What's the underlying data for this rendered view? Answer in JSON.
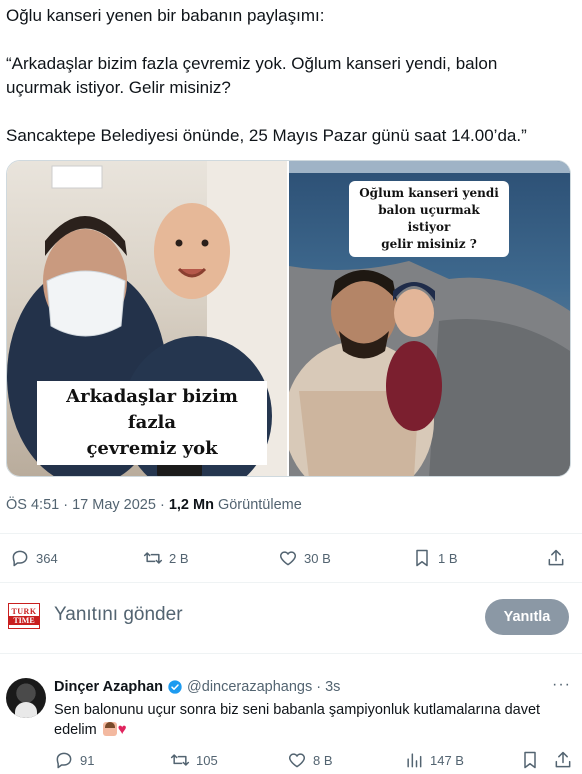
{
  "tweet": {
    "line1": "Oğlu kanseri yenen bir babanın paylaşımı:",
    "line2": "“Arkadaşlar bizim fazla çevremiz yok. Oğlum kanseri yendi, balon",
    "line3": "uçurmak istiyor. Gelir misiniz?",
    "line4": "Sancaktepe Belediyesi önünde, 25 Mayıs Pazar günü saat 14.00’da.”"
  },
  "media": {
    "left_caption_line1": "Arkadaşlar bizim fazla",
    "left_caption_line2": "çevremiz yok",
    "right_caption_line1": "Oğlum kanseri yendi",
    "right_caption_line2": "balon uçurmak istiyor",
    "right_caption_line3": "gelir misiniz ?"
  },
  "meta": {
    "time": "ÖS 4:51 · 17 May 2025 · ",
    "views_count": "1,2 Mn",
    "views_label": " Görüntüleme"
  },
  "actions": {
    "replies": "364",
    "retweets": "2 B",
    "likes": "30 B",
    "bookmarks": "1 B"
  },
  "compose": {
    "logo_top": "TURK",
    "logo_bottom": "TIME",
    "placeholder": "Yanıtını gönder",
    "reply_button": "Yanıtla"
  },
  "reply": {
    "name": "Dinçer Azaphan",
    "handle": "@dincerazaphangs",
    "time": "· 3s",
    "text": "Sen balonunu uçur sonra biz seni babanla şampiyonluk kutlamalarına davet",
    "text_line2": "edelim",
    "replies": "91",
    "retweets": "105",
    "likes": "8 B",
    "views": "147 B"
  },
  "colors": {
    "accent": "#1d9bf0",
    "muted": "#536471",
    "reply_button_bg": "#8b98a5",
    "heart": "#e0245e"
  },
  "icons": [
    "reply-icon",
    "retweet-icon",
    "like-icon",
    "bookmark-icon",
    "share-icon",
    "more-icon",
    "verified-icon",
    "views-icon"
  ]
}
